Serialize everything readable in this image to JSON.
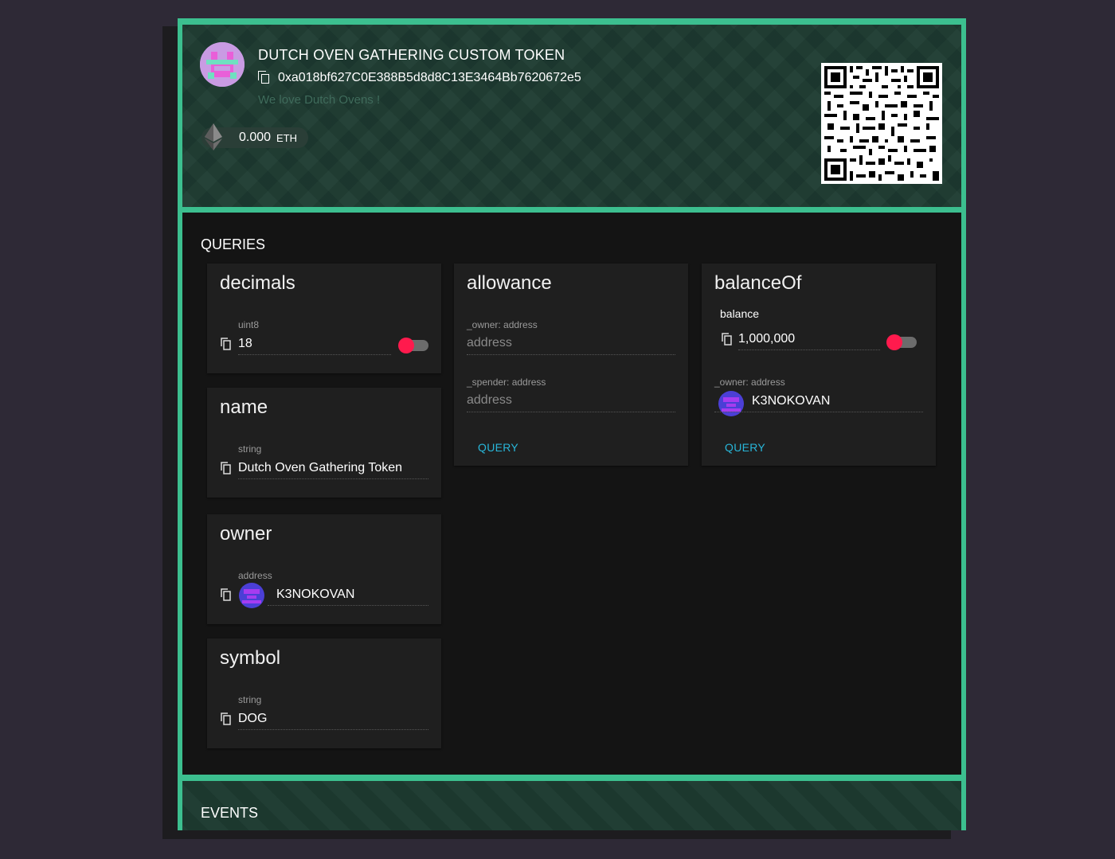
{
  "token": {
    "name": "DUTCH OVEN GATHERING CUSTOM TOKEN",
    "address": "0xa018bf627C0E388B5d8d8C13E3464Bb7620672e5",
    "tagline": "We love Dutch Ovens !",
    "balance": "0.000",
    "balance_unit": "ETH"
  },
  "queries": {
    "title": "QUERIES",
    "decimals": {
      "title": "decimals",
      "type": "uint8",
      "value": "18"
    },
    "name": {
      "title": "name",
      "type": "string",
      "value": "Dutch Oven Gathering Token"
    },
    "owner": {
      "title": "owner",
      "type": "address",
      "value": "K3NOKOVAN"
    },
    "symbol": {
      "title": "symbol",
      "type": "string",
      "value": "DOG"
    },
    "allowance": {
      "title": "allowance",
      "owner_label": "_owner: address",
      "owner_placeholder": "address",
      "spender_label": "_spender: address",
      "spender_placeholder": "address",
      "button": "QUERY"
    },
    "balanceOf": {
      "title": "balanceOf",
      "result_label": "balance",
      "result_value": "1,000,000",
      "owner_label": "_owner: address",
      "owner_value": "K3NOKOVAN",
      "button": "QUERY"
    }
  },
  "events": {
    "title": "EVENTS"
  },
  "colors": {
    "frame": "#3cbf8f",
    "header_bg": "#1d3a30",
    "toggle_knob": "#ff1a4d",
    "query_button": "#28b6d9"
  },
  "icons": [
    "copy-icon",
    "ethereum-icon",
    "qr-code",
    "token-identicon",
    "owner-identicon"
  ]
}
